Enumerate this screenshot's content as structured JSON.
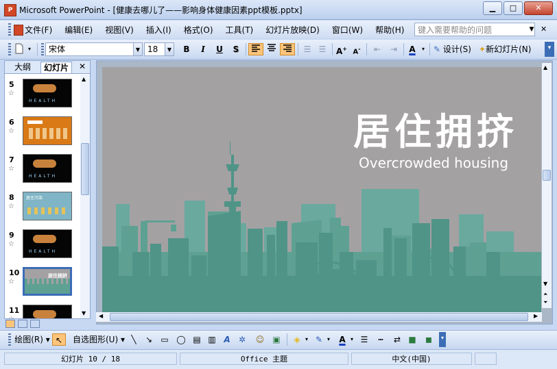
{
  "window": {
    "title": "Microsoft PowerPoint - [健康去哪儿了——影响身体健康因素ppt模板.pptx]",
    "app_badge": "P",
    "minimize": "▁",
    "maximize": "□",
    "close": "✕"
  },
  "menu": {
    "items": [
      "文件(F)",
      "编辑(E)",
      "视图(V)",
      "插入(I)",
      "格式(O)",
      "工具(T)",
      "幻灯片放映(D)",
      "窗口(W)",
      "帮助(H)"
    ],
    "help_placeholder": "键入需要帮助的问题",
    "doc_close": "✕"
  },
  "toolbar": {
    "font_name": "宋体",
    "font_size": "18",
    "bold": "B",
    "italic": "I",
    "underline": "U",
    "shadow": "S",
    "design": "设计(S)",
    "new_slide": "新幻灯片(N)"
  },
  "outline_panel": {
    "tab_outline": "大纲",
    "tab_slides": "幻灯片",
    "close": "✕",
    "thumbnails": [
      {
        "num": "5",
        "style": "dark",
        "selected": false
      },
      {
        "num": "6",
        "style": "orange",
        "selected": false
      },
      {
        "num": "7",
        "style": "dark",
        "selected": false
      },
      {
        "num": "8",
        "style": "teal",
        "selected": false
      },
      {
        "num": "9",
        "style": "dark",
        "selected": false
      },
      {
        "num": "10",
        "style": "gray",
        "selected": true
      },
      {
        "num": "11",
        "style": "dark",
        "selected": false
      }
    ],
    "thumb_texts": {
      "health": "HEALTH",
      "mini_title": "居住拥挤",
      "teal_title": "居住污染"
    }
  },
  "slide": {
    "title": "居住拥挤",
    "subtitle": "Overcrowded housing"
  },
  "drawbar": {
    "draw": "绘图(R)",
    "autoshapes": "自选图形(U)"
  },
  "status": {
    "slide_pos": "幻灯片 10 / 18",
    "theme": "Office 主题",
    "language": "中文(中国)"
  },
  "colors": {
    "slide_bg": "#a4a1a3",
    "city_back": "#6aa99e",
    "city_mid": "#5ea193",
    "city_front": "#4f9487",
    "highlight": "#fcc47a"
  }
}
